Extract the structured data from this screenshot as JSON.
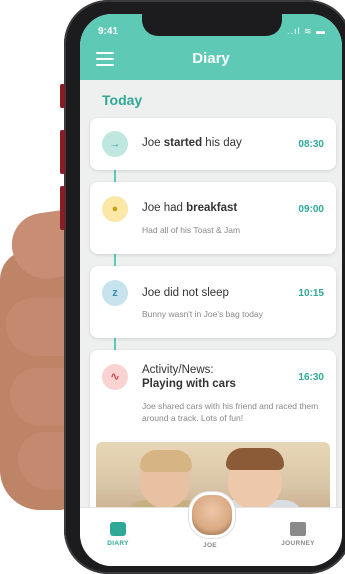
{
  "status": {
    "time": "9:41",
    "icons": "..ıl ≋ ▬"
  },
  "header": {
    "title": "Diary"
  },
  "section": {
    "today": "Today"
  },
  "entries": [
    {
      "pre": "Joe ",
      "strong": "started",
      "post": " his day",
      "time": "08:30",
      "sub": "",
      "icon": "enter-icon"
    },
    {
      "pre": "Joe had ",
      "strong": "breakfast",
      "post": "",
      "time": "09:00",
      "sub": "Had all of his Toast & Jam",
      "icon": "meal-icon"
    },
    {
      "pre": "Joe did not sleep",
      "strong": "",
      "post": "",
      "time": "10:15",
      "sub": "Bunny wasn't in Joe's bag today",
      "icon": "sleep-icon"
    },
    {
      "pre": "Activity/News:",
      "strong": "Playing with cars",
      "post": "",
      "time": "16:30",
      "sub": "Joe shared cars with his friend and raced them around a track. Lots of fun!",
      "icon": "activity-icon"
    }
  ],
  "tabs": {
    "diary": "DIARY",
    "joe": "JOE",
    "journey": "JOURNEY"
  },
  "colors": {
    "accent": "#5ec9b4",
    "accent_dark": "#2fa897"
  }
}
